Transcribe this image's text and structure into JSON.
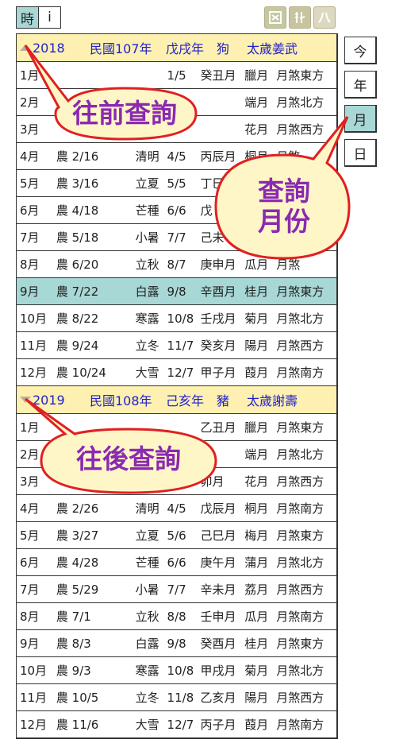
{
  "topbar": {
    "shi_label": "時",
    "info_label": "i"
  },
  "years": [
    {
      "year": "2018",
      "roc": "民國107年",
      "ganzhi": "戊戌年",
      "zodiac": "狗",
      "taisui": "太歲姜武",
      "rows": [
        {
          "m": "1月",
          "l": "",
          "t": "",
          "d": "1/5",
          "g": "癸丑月",
          "n": "臘月",
          "s": "月煞東方"
        },
        {
          "m": "2月",
          "l": "",
          "t": "",
          "d": "",
          "g": "",
          "n": "端月",
          "s": "月煞北方"
        },
        {
          "m": "3月",
          "l": "",
          "t": "",
          "d": "",
          "g": "",
          "n": "花月",
          "s": "月煞西方"
        },
        {
          "m": "4月",
          "l": "農 2/16",
          "t": "清明",
          "d": "4/5",
          "g": "丙辰月",
          "n": "桐月",
          "s": "月煞"
        },
        {
          "m": "5月",
          "l": "農 3/16",
          "t": "立夏",
          "d": "5/5",
          "g": "丁巳",
          "n": "",
          "s": ""
        },
        {
          "m": "6月",
          "l": "農 4/18",
          "t": "芒種",
          "d": "6/6",
          "g": "戊",
          "n": "",
          "s": ""
        },
        {
          "m": "7月",
          "l": "農 5/18",
          "t": "小暑",
          "d": "7/7",
          "g": "己未",
          "n": "",
          "s": ""
        },
        {
          "m": "8月",
          "l": "農 6/20",
          "t": "立秋",
          "d": "8/7",
          "g": "庚申月",
          "n": "瓜月",
          "s": "月煞"
        },
        {
          "m": "9月",
          "l": "農 7/22",
          "t": "白露",
          "d": "9/8",
          "g": "辛酉月",
          "n": "桂月",
          "s": "月煞東方",
          "hl": true
        },
        {
          "m": "10月",
          "l": "農 8/22",
          "t": "寒露",
          "d": "10/8",
          "g": "壬戌月",
          "n": "菊月",
          "s": "月煞北方"
        },
        {
          "m": "11月",
          "l": "農 9/24",
          "t": "立冬",
          "d": "11/7",
          "g": "癸亥月",
          "n": "陽月",
          "s": "月煞西方"
        },
        {
          "m": "12月",
          "l": "農 10/24",
          "t": "大雪",
          "d": "12/7",
          "g": "甲子月",
          "n": "葭月",
          "s": "月煞南方"
        }
      ]
    },
    {
      "year": "2019",
      "roc": "民國108年",
      "ganzhi": "己亥年",
      "zodiac": "豬",
      "taisui": "太歲謝壽",
      "rows": [
        {
          "m": "1月",
          "l": "",
          "t": "",
          "d": "",
          "g": "乙丑月",
          "n": "臘月",
          "s": "月煞東方"
        },
        {
          "m": "2月",
          "l": "",
          "t": "",
          "d": "",
          "g": "",
          "n": "端月",
          "s": "月煞北方"
        },
        {
          "m": "3月",
          "l": "",
          "t": "",
          "d": "",
          "g": "卯月",
          "n": "花月",
          "s": "月煞西方"
        },
        {
          "m": "4月",
          "l": "農 2/26",
          "t": "清明",
          "d": "4/5",
          "g": "戊辰月",
          "n": "桐月",
          "s": "月煞南方"
        },
        {
          "m": "5月",
          "l": "農 3/27",
          "t": "立夏",
          "d": "5/6",
          "g": "己巳月",
          "n": "梅月",
          "s": "月煞東方"
        },
        {
          "m": "6月",
          "l": "農 4/28",
          "t": "芒種",
          "d": "6/6",
          "g": "庚午月",
          "n": "蒲月",
          "s": "月煞北方"
        },
        {
          "m": "7月",
          "l": "農 5/29",
          "t": "小暑",
          "d": "7/7",
          "g": "辛未月",
          "n": "荔月",
          "s": "月煞西方"
        },
        {
          "m": "8月",
          "l": "農 7/1",
          "t": "立秋",
          "d": "8/8",
          "g": "壬申月",
          "n": "瓜月",
          "s": "月煞南方"
        },
        {
          "m": "9月",
          "l": "農 8/3",
          "t": "白露",
          "d": "9/8",
          "g": "癸酉月",
          "n": "桂月",
          "s": "月煞東方"
        },
        {
          "m": "10月",
          "l": "農 9/3",
          "t": "寒露",
          "d": "10/8",
          "g": "甲戌月",
          "n": "菊月",
          "s": "月煞北方"
        },
        {
          "m": "11月",
          "l": "農 10/5",
          "t": "立冬",
          "d": "11/8",
          "g": "乙亥月",
          "n": "陽月",
          "s": "月煞西方"
        },
        {
          "m": "12月",
          "l": "農 11/6",
          "t": "大雪",
          "d": "12/7",
          "g": "丙子月",
          "n": "葭月",
          "s": "月煞南方"
        }
      ]
    }
  ],
  "sidenav": [
    {
      "label": "今",
      "active": false
    },
    {
      "label": "年",
      "active": false
    },
    {
      "label": "月",
      "active": true
    },
    {
      "label": "日",
      "active": false
    }
  ],
  "callouts": {
    "prev": "往前查詢",
    "month_line1": "查詢",
    "month_line2": "月份",
    "next": "往後查詢"
  },
  "colors": {
    "highlight": "#a8d8d6",
    "year_header_bg": "#fdf0b0",
    "year_header_text": "#2222cc",
    "callout_text": "#8a2ab0",
    "callout_fill": "#fff6c8",
    "callout_stroke": "#e02020"
  }
}
